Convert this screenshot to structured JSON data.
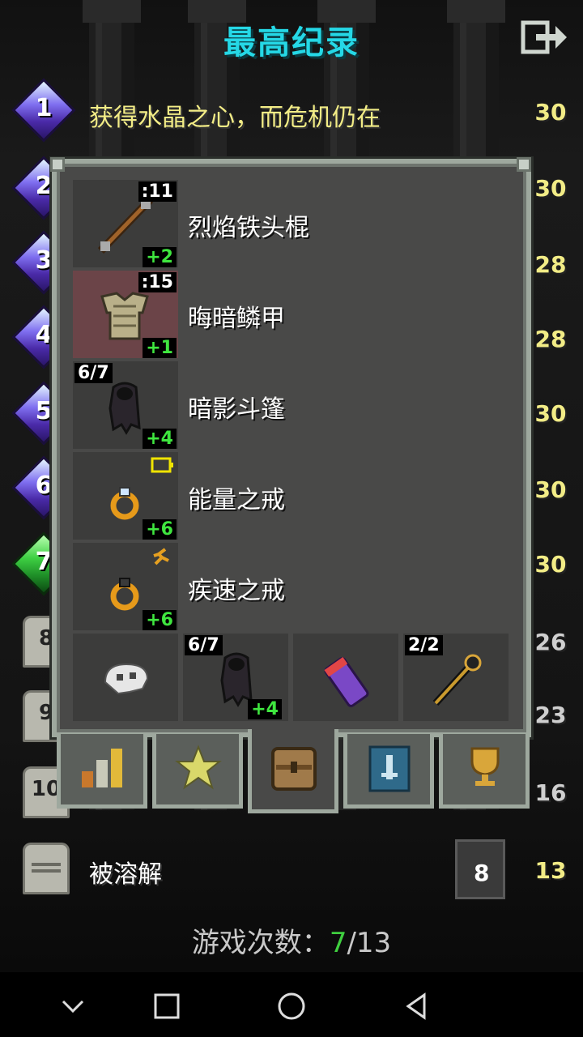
{
  "header": {
    "title": "最高纪录",
    "exit_icon": "exit-icon"
  },
  "records": {
    "rank_labels": [
      "1",
      "2",
      "3",
      "4",
      "5",
      "6",
      "7",
      "8",
      "9",
      "10"
    ],
    "first_record_text": "获得水晶之心，而危机仍在",
    "last_record_text": "被溶解",
    "levels": [
      "30",
      "30",
      "28",
      "28",
      "30",
      "30",
      "30",
      "26",
      "23",
      "16",
      "13"
    ],
    "last_depth": "8"
  },
  "inventory": {
    "equipped": [
      {
        "name": "烈焰铁头棍",
        "qty": ":11",
        "upgrade": "+2",
        "icon": "quarterstaff-icon"
      },
      {
        "name": "晦暗鳞甲",
        "qty": ":15",
        "upgrade": "+1",
        "icon": "scale-armor-icon"
      },
      {
        "name": "暗影斗篷",
        "qty": "6/7",
        "upgrade": "+4",
        "icon": "shadow-cloak-icon"
      },
      {
        "name": "能量之戒",
        "qty": "",
        "upgrade": "+6",
        "icon": "ring-icon"
      },
      {
        "name": "疾速之戒",
        "qty": "",
        "upgrade": "+6",
        "icon": "ring-icon"
      }
    ],
    "bag": [
      {
        "qty": "",
        "upgrade": "",
        "icon": "skull-icon"
      },
      {
        "qty": "6/7",
        "upgrade": "+4",
        "icon": "shadow-cloak-icon"
      },
      {
        "qty": "",
        "upgrade": "",
        "icon": "quiver-icon"
      },
      {
        "qty": "2/2",
        "upgrade": "",
        "icon": "wand-icon"
      }
    ]
  },
  "tabs": [
    {
      "icon": "stats-icon"
    },
    {
      "icon": "star-icon"
    },
    {
      "icon": "backpack-icon",
      "active": true
    },
    {
      "icon": "catalog-icon"
    },
    {
      "icon": "trophy-icon"
    }
  ],
  "footer": {
    "label": "游戏次数：",
    "current": "7",
    "total": "/13"
  },
  "colors": {
    "title": "#25d8e6",
    "record_text": "#f2ec86",
    "upgrade": "#3fe63f",
    "selected_slot": "#6b4448",
    "current_count": "#3fcf3f"
  }
}
